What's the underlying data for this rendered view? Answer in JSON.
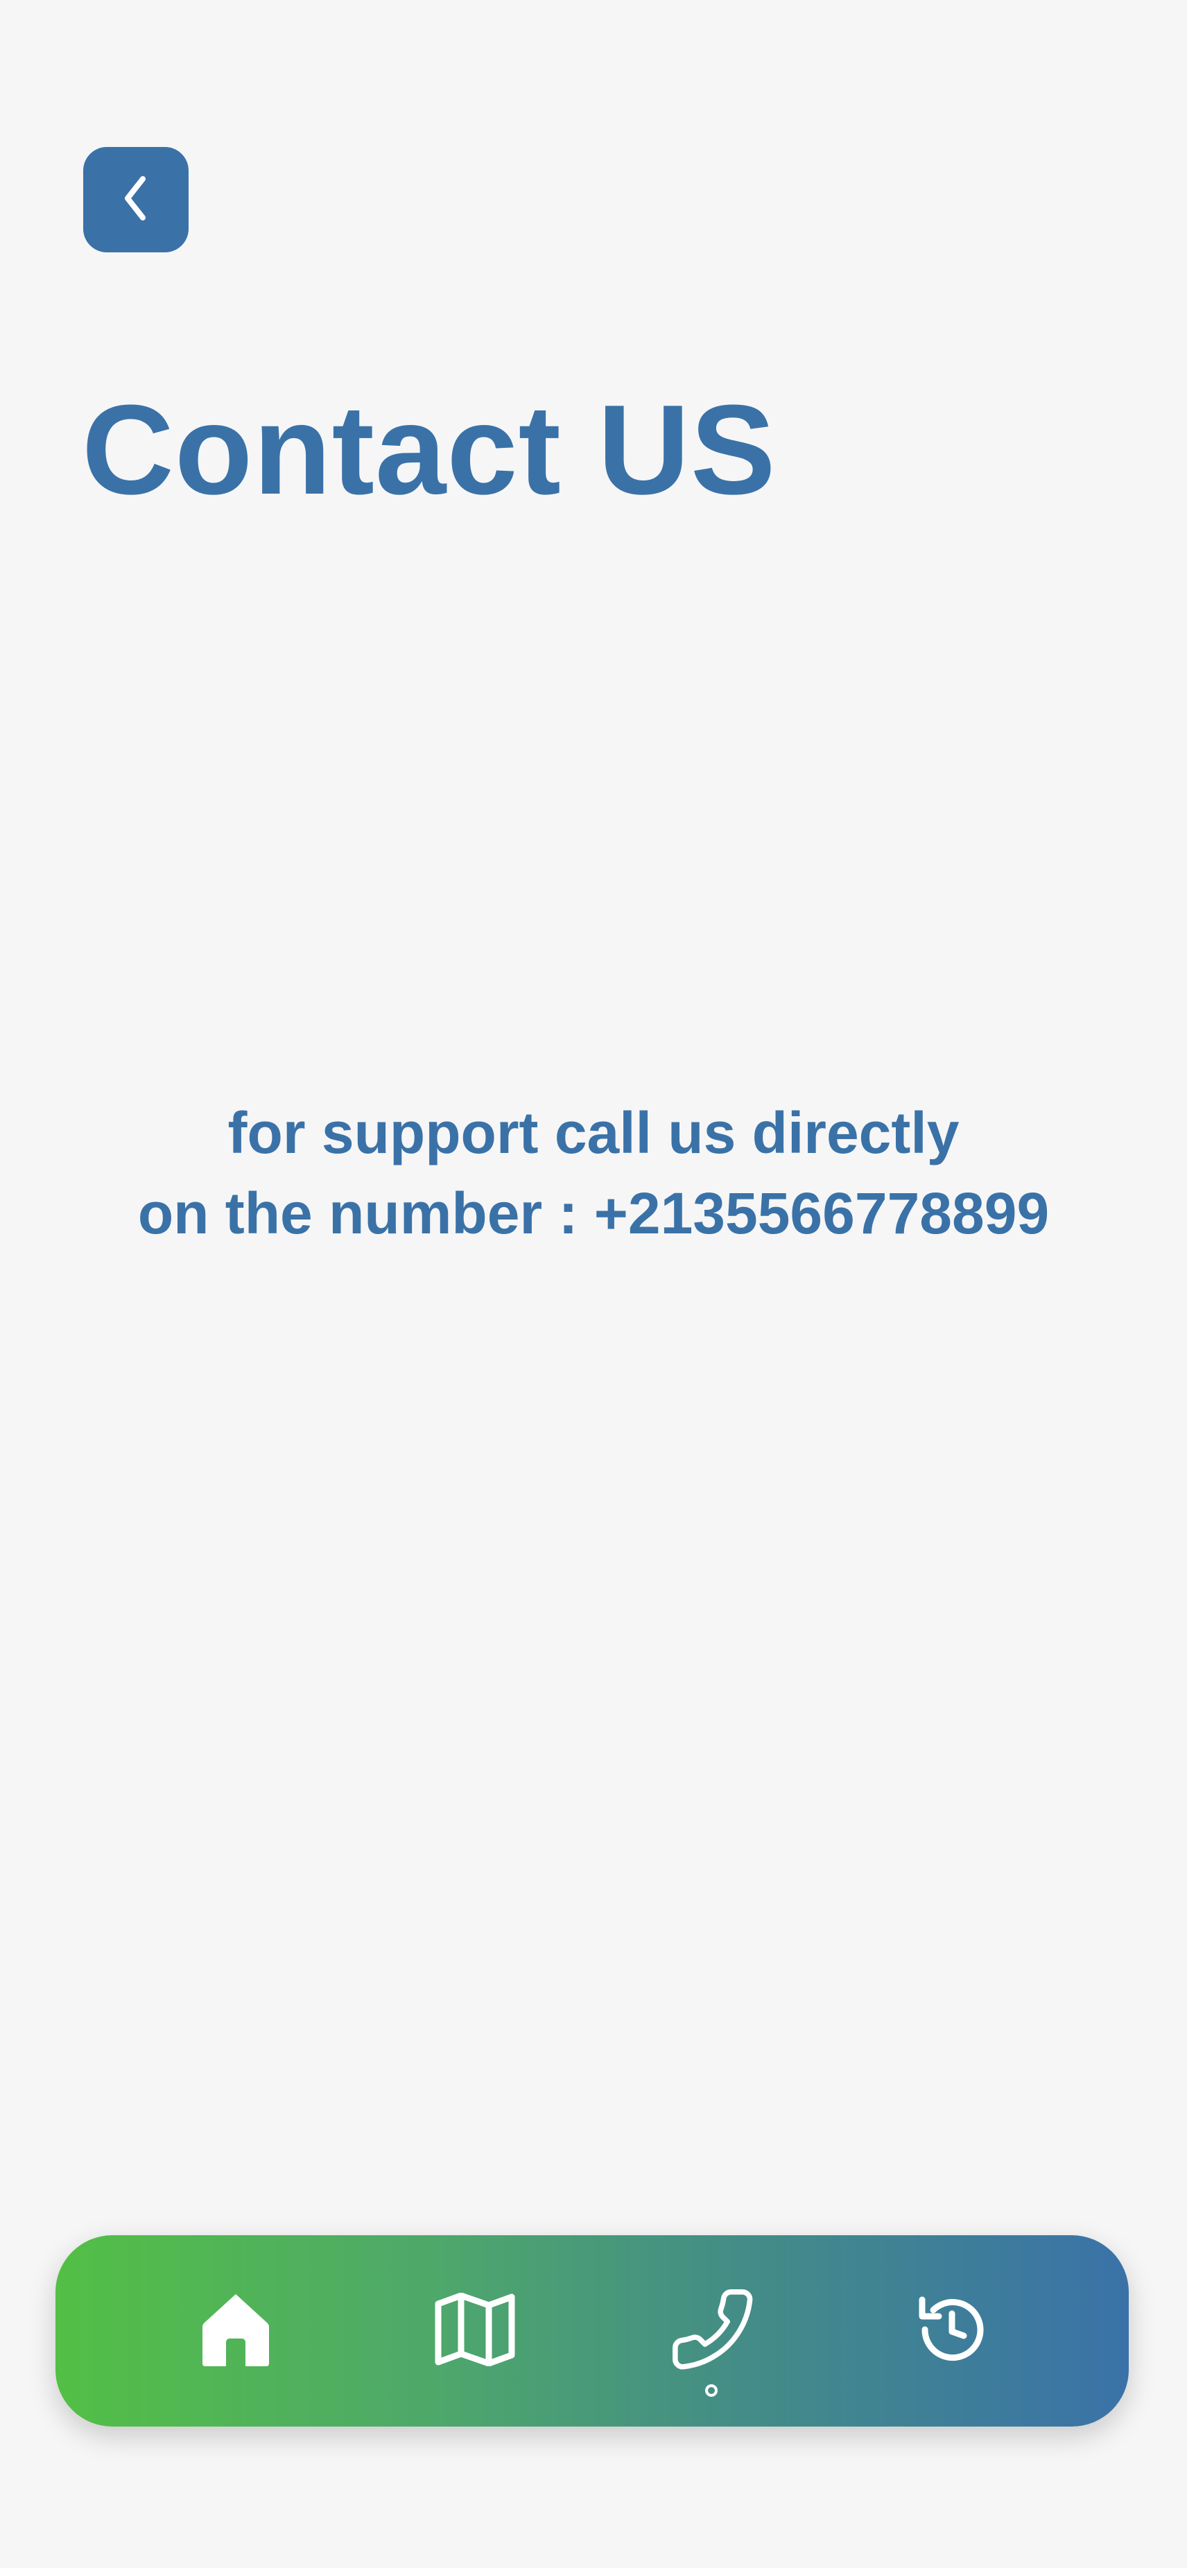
{
  "header": {
    "back_icon": "chevron-left-icon",
    "title": "Contact US"
  },
  "support": {
    "line1": "for support call us directly",
    "line2_prefix": "on the number : ",
    "phone": "+2135566778899"
  },
  "bottom_nav": {
    "items": [
      {
        "icon": "home-icon",
        "active": false
      },
      {
        "icon": "map-icon",
        "active": false
      },
      {
        "icon": "phone-icon",
        "active": true
      },
      {
        "icon": "history-icon",
        "active": false
      }
    ],
    "gradient_start": "#53bf45",
    "gradient_end": "#3a72a8"
  },
  "colors": {
    "accent": "#3a72a8",
    "background": "#f6f6f6",
    "icon": "#ffffff"
  }
}
